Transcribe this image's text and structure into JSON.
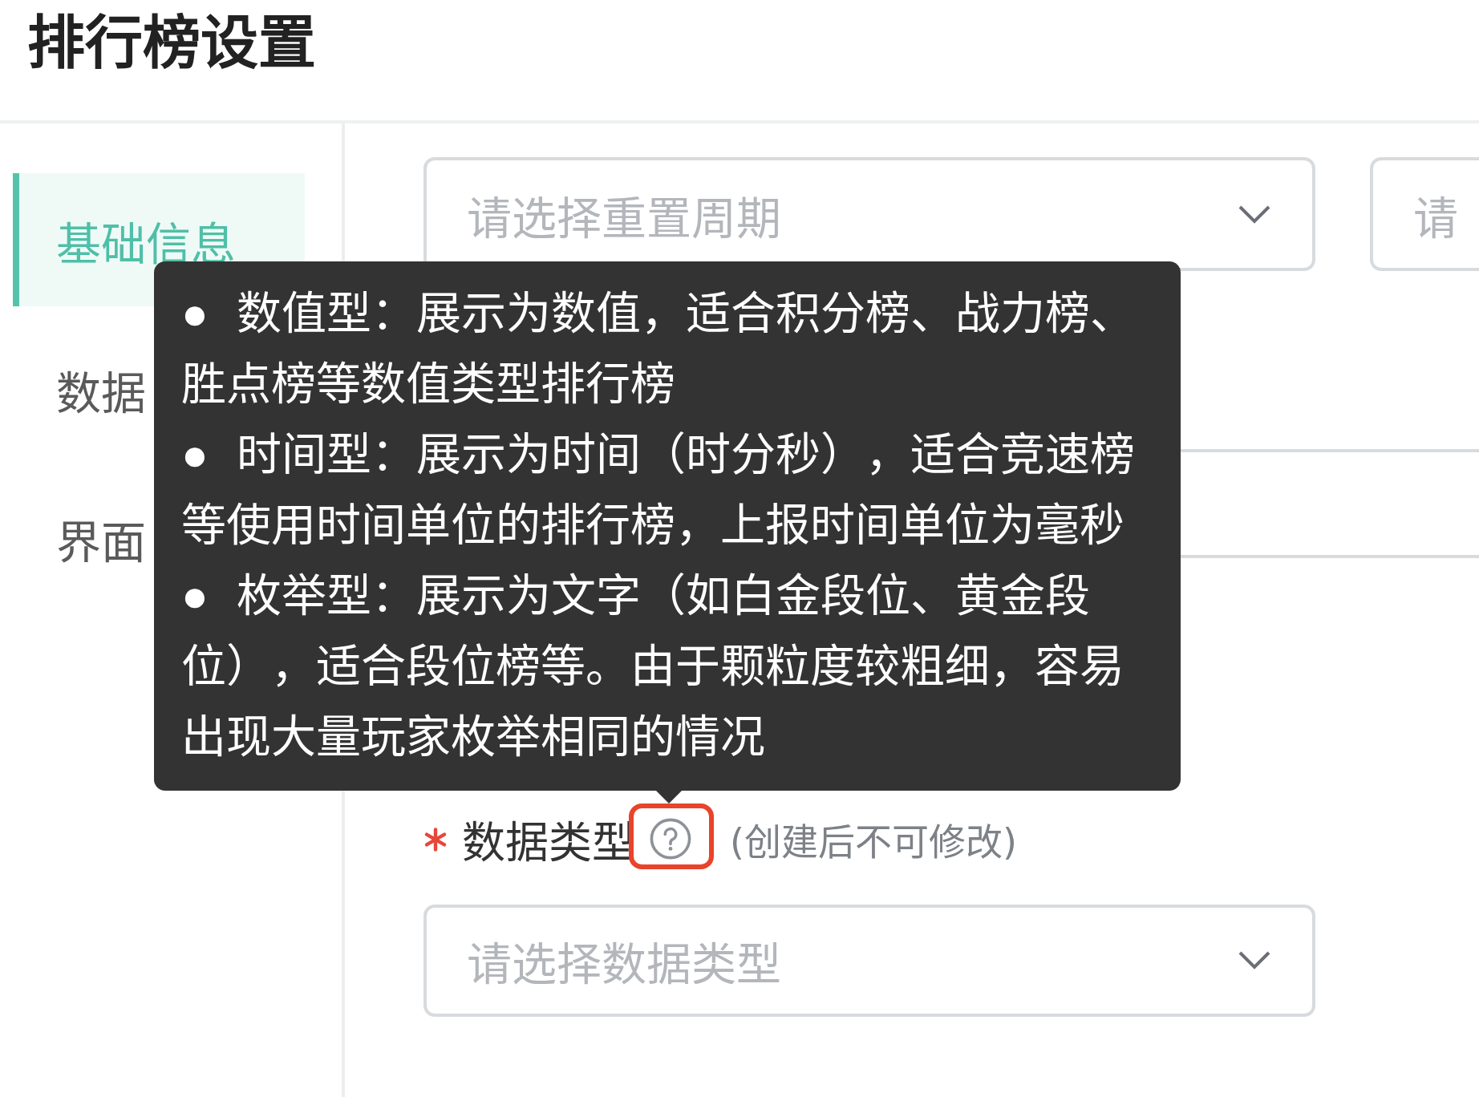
{
  "page": {
    "title": "排行榜设置"
  },
  "sidebar": {
    "items": [
      {
        "label": "基础信息",
        "selected": true
      },
      {
        "label": "数据",
        "selected": false
      },
      {
        "label": "界面",
        "selected": false
      }
    ]
  },
  "form": {
    "rows": [
      {
        "kind": "select_group",
        "selects": [
          {
            "placeholder": "请选择重置周期"
          },
          {
            "placeholder": "请"
          }
        ]
      },
      {
        "kind": "input"
      },
      {
        "kind": "label",
        "text": "数据类型",
        "required": true,
        "help_icon": {
          "highlighted": true
        },
        "note": "(创建后不可修改)"
      },
      {
        "kind": "select",
        "placeholder": "请选择数据类型"
      }
    ]
  },
  "tooltip": {
    "items": [
      "● 数值型：展示为数值，适合积分榜、战力榜、胜点榜等数值类型排行榜",
      "● 时间型：展示为时间（时分秒），适合竞速榜等使用时间单位的排行榜，上报时间单位为毫秒",
      "● 枚举型：展示为文字（如白金段位、黄金段位），适合段位榜等。由于颗粒度较粗细，容易出现大量玩家枚举相同的情况"
    ]
  }
}
